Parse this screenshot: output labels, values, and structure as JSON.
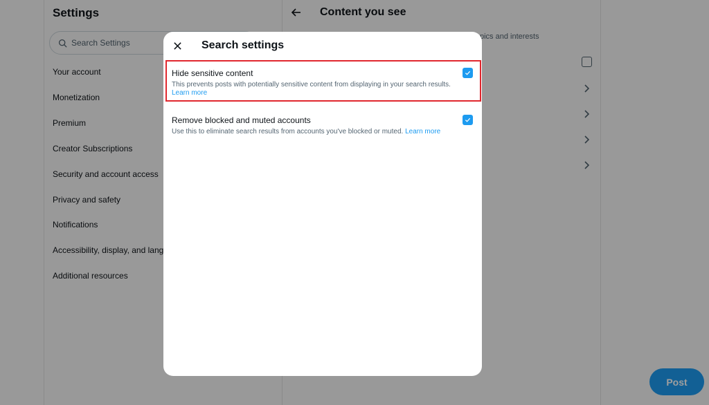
{
  "settings": {
    "title": "Settings",
    "search_placeholder": "Search Settings",
    "nav_items": [
      {
        "label": "Your account"
      },
      {
        "label": "Monetization"
      },
      {
        "label": "Premium"
      },
      {
        "label": "Creator Subscriptions"
      },
      {
        "label": "Security and account access"
      },
      {
        "label": "Privacy and safety"
      },
      {
        "label": "Notifications"
      },
      {
        "label": "Accessibility, display, and languages"
      },
      {
        "label": "Additional resources"
      }
    ]
  },
  "main": {
    "title": "Content you see",
    "subtitle_partial": "pics and interests",
    "icons": [
      "arrow-left-icon",
      "checkbox-icon",
      "chevron-right-icon"
    ]
  },
  "modal": {
    "title": "Search settings",
    "options": [
      {
        "label": "Hide sensitive content",
        "description": "This prevents posts with potentially sensitive content from displaying in your search results.",
        "link": "Learn more",
        "checked": true,
        "highlighted": true
      },
      {
        "label": "Remove blocked and muted accounts",
        "description": "Use this to eliminate search results from accounts you've blocked or muted.",
        "link": "Learn more",
        "checked": true,
        "highlighted": false
      }
    ]
  },
  "post_button": {
    "label": "Post"
  },
  "colors": {
    "accent": "#1d9bf0",
    "highlight_border": "#e0262d",
    "overlay": "rgba(0,0,0,0.40)"
  }
}
